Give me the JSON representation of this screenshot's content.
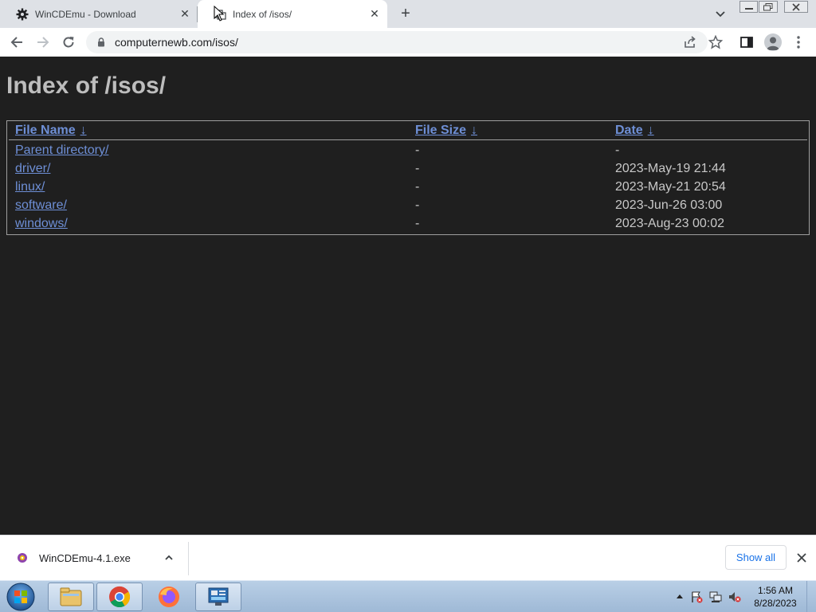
{
  "browser": {
    "tabs": [
      {
        "title": "WinCDEmu - Download",
        "active": false,
        "icon": "gear-icon"
      },
      {
        "title": "Index of /isos/",
        "active": true,
        "icon": "folder-icon"
      }
    ],
    "url": "computernewb.com/isos/"
  },
  "page": {
    "title": "Index of /isos/",
    "columns": [
      {
        "label": "File Name",
        "sort": "↓"
      },
      {
        "label": "File Size",
        "sort": "↓"
      },
      {
        "label": "Date",
        "sort": "↓"
      }
    ],
    "rows": [
      {
        "name": "Parent directory/",
        "size": "-",
        "date": "-"
      },
      {
        "name": "driver/",
        "size": "-",
        "date": "2023-May-19 21:44"
      },
      {
        "name": "linux/",
        "size": "-",
        "date": "2023-May-21 20:54"
      },
      {
        "name": "software/",
        "size": "-",
        "date": "2023-Jun-26 03:00"
      },
      {
        "name": "windows/",
        "size": "-",
        "date": "2023-Aug-23 00:02"
      }
    ]
  },
  "downloads": {
    "file_name": "WinCDEmu-4.1.exe",
    "show_all_label": "Show all"
  },
  "taskbar": {
    "apps": [
      "windows-explorer",
      "google-chrome",
      "firefox",
      "control-panel"
    ],
    "time": "1:56 AM",
    "date": "8/28/2023"
  },
  "colors": {
    "page_background": "#1f1f1f",
    "link": "#6e8fd6",
    "heading": "#bdbdbd"
  }
}
